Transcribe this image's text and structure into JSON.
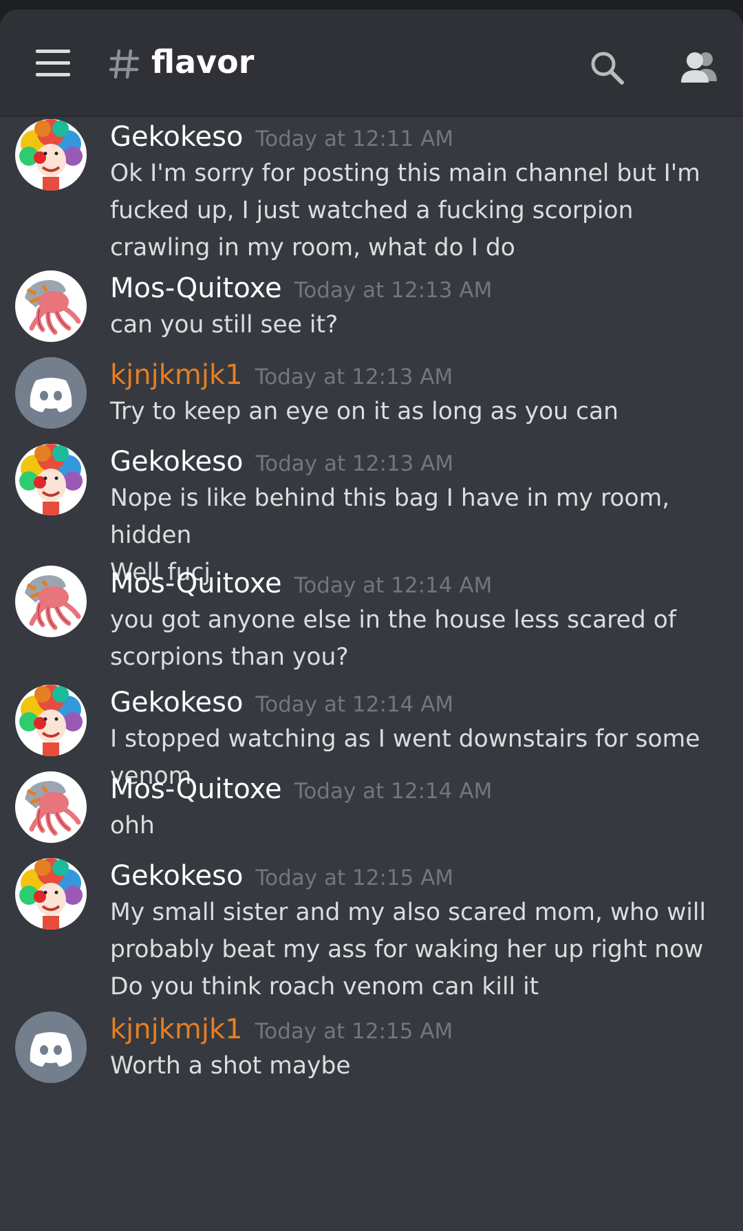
{
  "header": {
    "channel_name": "flavor",
    "icons": [
      "hamburger-menu-icon",
      "hash-icon",
      "search-icon",
      "members-icon"
    ]
  },
  "colors": {
    "background": "#36393f",
    "header": "#2f3136",
    "username_default": "#ffffff",
    "username_role": "#e67e22",
    "timestamp": "#72767d",
    "message_text": "#dcddde"
  },
  "messages": [
    {
      "author": "Gekokeso",
      "timestamp": "Today at 12:11 AM",
      "avatar": "clown-avatar",
      "text": "Ok I'm sorry for posting this main channel but I'm fucked up, I just watched a fucking scorpion crawling in my room, what do I do"
    },
    {
      "author": "Mos-Quitoxe",
      "timestamp": "Today at 12:13 AM",
      "avatar": "octopus-avatar",
      "text": "can you still see it?"
    },
    {
      "author": "kjnjkmjk1",
      "timestamp": "Today at 12:13 AM",
      "avatar": "discord-default-avatar",
      "text": "Try to keep an eye on it as long as you can"
    },
    {
      "author": "Gekokeso",
      "timestamp": "Today at 12:13 AM",
      "avatar": "clown-avatar",
      "text": "Nope is like behind this bag I have in my room, hidden\nWell fucj"
    },
    {
      "author": "Mos-Quitoxe",
      "timestamp": "Today at 12:14 AM",
      "avatar": "octopus-avatar",
      "text": "you got anyone else in the house less scared of scorpions than you?"
    },
    {
      "author": "Gekokeso",
      "timestamp": "Today at 12:14 AM",
      "avatar": "clown-avatar",
      "text": "I stopped watching as I went downstairs for some venom"
    },
    {
      "author": "Mos-Quitoxe",
      "timestamp": "Today at 12:14 AM",
      "avatar": "octopus-avatar",
      "text": "ohh"
    },
    {
      "author": "Gekokeso",
      "timestamp": "Today at 12:15 AM",
      "avatar": "clown-avatar",
      "text": "My small sister and my also scared mom, who will probably beat my ass for waking her up right now\nDo you think roach venom can kill it"
    },
    {
      "author": "kjnjkmjk1",
      "timestamp": "Today at 12:15 AM",
      "avatar": "discord-default-avatar",
      "text": "Worth a shot maybe"
    }
  ]
}
